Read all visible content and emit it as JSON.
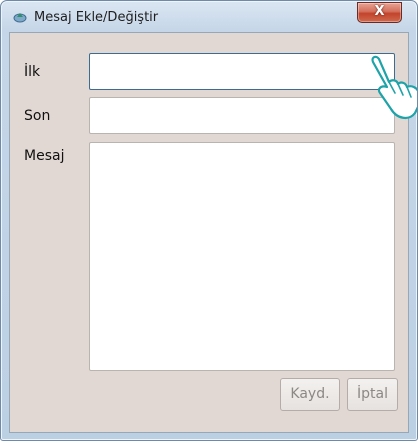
{
  "window": {
    "title": "Mesaj Ekle/Değiştir",
    "app_icon": "app-icon",
    "close_glyph": "X"
  },
  "form": {
    "first_label": "İlk",
    "first_value": "",
    "last_label": "Son",
    "last_value": "",
    "message_label": "Mesaj",
    "message_value": ""
  },
  "buttons": {
    "save_label": "Kayd.",
    "cancel_label": "İptal"
  },
  "colors": {
    "client_bg": "#e2d8d3",
    "close_red": "#c2442c",
    "focus_border": "#3d6c93"
  }
}
